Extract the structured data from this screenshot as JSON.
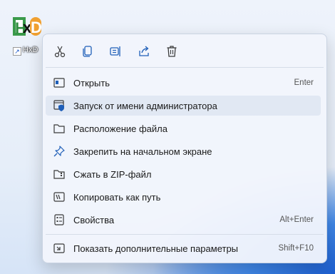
{
  "desktop_icon": {
    "label": "HxD",
    "logo_text": "HxD"
  },
  "toolbar": {
    "buttons": [
      {
        "icon": "cut-icon"
      },
      {
        "icon": "copy-icon"
      },
      {
        "icon": "rename-icon"
      },
      {
        "icon": "share-icon"
      },
      {
        "icon": "delete-icon"
      }
    ]
  },
  "menu": {
    "items": [
      {
        "label": "Открыть",
        "shortcut": "Enter",
        "icon": "open-icon"
      },
      {
        "label": "Запуск от имени администратора",
        "shortcut": "",
        "icon": "shield-icon"
      },
      {
        "label": "Расположение файла",
        "shortcut": "",
        "icon": "folder-icon"
      },
      {
        "label": "Закрепить на начальном экране",
        "shortcut": "",
        "icon": "pin-icon"
      },
      {
        "label": "Сжать в ZIP-файл",
        "shortcut": "",
        "icon": "zip-folder-icon"
      },
      {
        "label": "Копировать как путь",
        "shortcut": "",
        "icon": "copy-path-icon"
      },
      {
        "label": "Свойства",
        "shortcut": "Alt+Enter",
        "icon": "properties-icon"
      }
    ],
    "more": {
      "label": "Показать дополнительные параметры",
      "shortcut": "Shift+F10",
      "icon": "more-options-icon"
    }
  },
  "colors": {
    "accent": "#0063b1",
    "menu_bg": "#f1f5fc",
    "highlight": "#e1e8f3"
  }
}
